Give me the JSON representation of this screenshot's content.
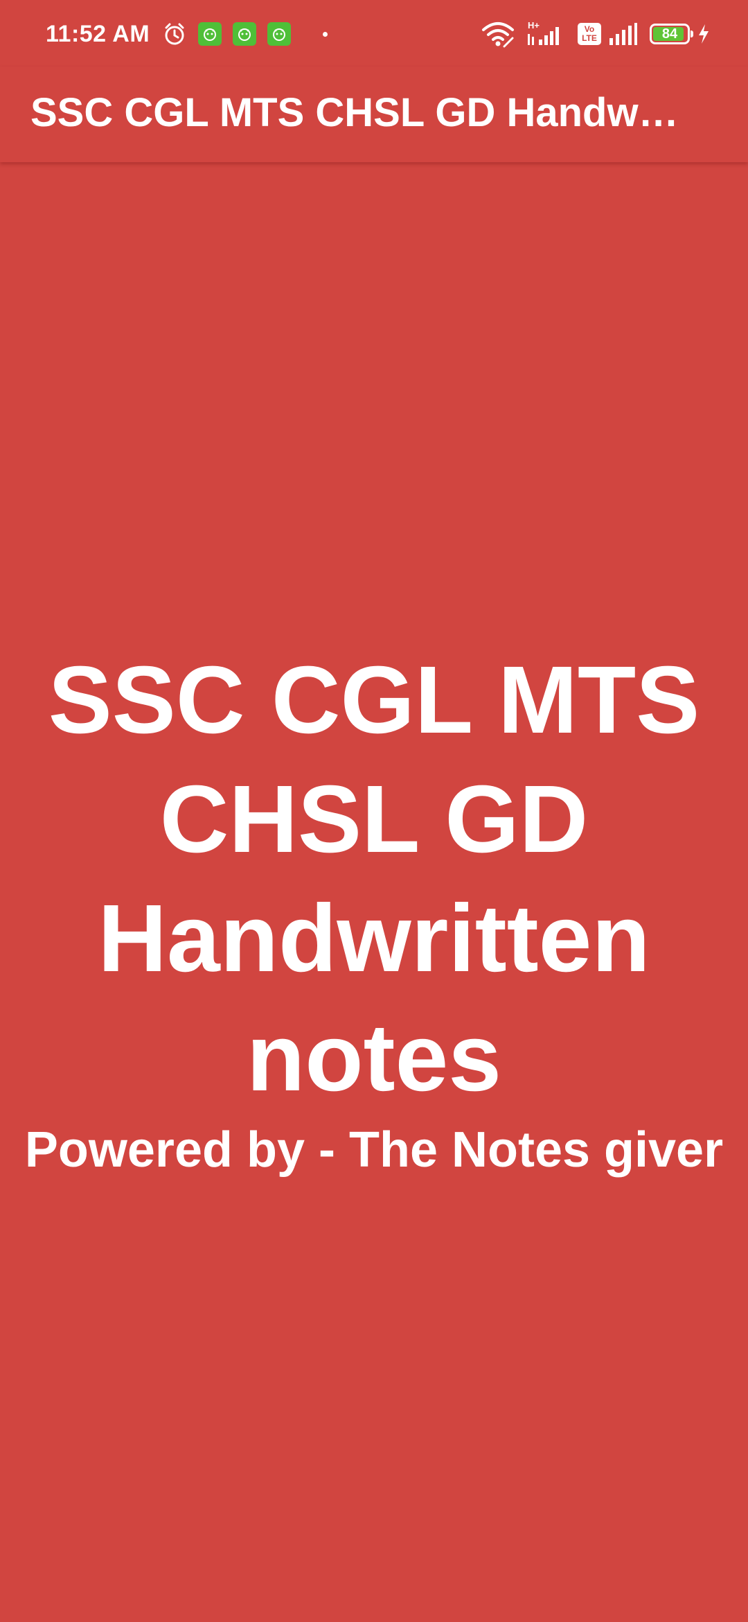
{
  "status_bar": {
    "time": "11:52 AM",
    "notification_icons": [
      "alarm-icon",
      "app-notification-icon",
      "app-notification-icon",
      "app-notification-icon"
    ],
    "more_indicator": "dot-icon",
    "network_badge": "H+",
    "volte_label_top": "Vo",
    "volte_label_bottom": "LTE",
    "battery_level": "84",
    "charging": true
  },
  "app_bar": {
    "title": "SSC CGL MTS CHSL GD Handwritten notes"
  },
  "splash": {
    "title": "SSC CGL MTS CHSL GD Handwritten notes",
    "subtitle": "Powered by - The Notes giver"
  },
  "colors": {
    "primary": "#d14540",
    "text": "#ffffff",
    "notification_app": "#4fbf38",
    "battery_fill": "#5fc436"
  }
}
